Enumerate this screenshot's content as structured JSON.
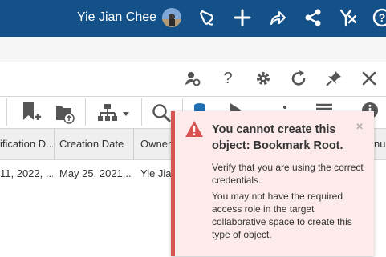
{
  "header": {
    "user_name": "Yie Jian Chee",
    "icons": [
      "avatar",
      "notification-bell-icon",
      "plus-icon",
      "share-arrow-icon",
      "share-network-icon",
      "accessibility-icon",
      "help-icon"
    ]
  },
  "panel_toolbar": {
    "help_label": "?",
    "icons": [
      "user-settings-icon",
      "help-icon",
      "gear-icon",
      "refresh-icon",
      "pin-icon",
      "close-icon"
    ]
  },
  "toolbar": {
    "icons": [
      "add-bookmark-icon",
      "upload-folder-icon",
      "hierarchy-icon",
      "chevron-down-icon",
      "search-icon",
      "database-icon",
      "play-icon",
      "more-icon",
      "menu-icon",
      "info-icon"
    ]
  },
  "table": {
    "columns": [
      "ification D...",
      "Creation Date",
      "Owner",
      "nu"
    ],
    "rows": [
      {
        "modification": "11, 2022, ...",
        "creation": "May 25, 2021,...",
        "owner": "Yie Jian"
      }
    ]
  },
  "toast": {
    "title": "You cannot create this object: Bookmark Root.",
    "message1": "Verify that you are using the correct credentials.",
    "message2": "You may not have the required access role in the target collaborative space to create this type of object.",
    "close_label": "×",
    "accent_color": "#d9534f",
    "background_color": "#fcebea"
  },
  "colors": {
    "header_bg": "#135188"
  }
}
